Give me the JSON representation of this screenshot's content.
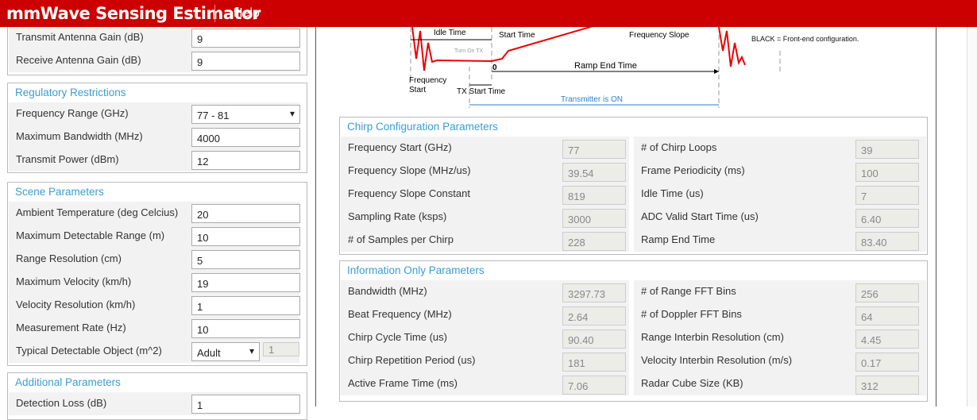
{
  "header": {
    "title": "mmWave Sensing Estimator",
    "help": "Help"
  },
  "antenna": {
    "rows": [
      {
        "label": "Transmit Antenna Gain (dB)",
        "value": "9"
      },
      {
        "label": "Receive Antenna Gain (dB)",
        "value": "9"
      }
    ]
  },
  "regulatory": {
    "title": "Regulatory Restrictions",
    "rows": [
      {
        "label": "Frequency Range (GHz)",
        "value": "77 - 81"
      },
      {
        "label": "Maximum Bandwidth (MHz)",
        "value": "4000"
      },
      {
        "label": "Transmit Power (dBm)",
        "value": "12"
      }
    ]
  },
  "scene": {
    "title": "Scene Parameters",
    "rows": [
      {
        "label": "Ambient Temperature (deg Celcius)",
        "value": "20"
      },
      {
        "label": "Maximum Detectable Range (m)",
        "value": "10"
      },
      {
        "label": "Range Resolution (cm)",
        "value": "5"
      },
      {
        "label": "Maximum Velocity (km/h)",
        "value": "19"
      },
      {
        "label": "Velocity Resolution (km/h)",
        "value": "1"
      },
      {
        "label": "Measurement Rate (Hz)",
        "value": "10"
      }
    ],
    "object_label": "Typical Detectable Object (m^2)",
    "object_value": "Adult",
    "object_rcs": "1"
  },
  "additional": {
    "title": "Additional Parameters",
    "rows": [
      {
        "label": "Detection Loss (dB)",
        "value": "1"
      }
    ]
  },
  "diagram": {
    "idle": "Idle Time",
    "start": "Start Time",
    "slope": "Frequency Slope",
    "legend": "BLACK = Front-end configuration.",
    "turn_on": "Turn On TX",
    "zero": "0",
    "ramp_end": "Ramp End Time",
    "freq_start": "Frequency",
    "freq_start2": "Start",
    "tx_start": "TX Start Time",
    "tx_on": "Transmitter is ON"
  },
  "chirp": {
    "title": "Chirp Configuration Parameters",
    "left": [
      {
        "label": "Frequency Start (GHz)",
        "value": "77"
      },
      {
        "label": "Frequency Slope (MHz/us)",
        "value": "39.54"
      },
      {
        "label": "Frequency Slope Constant",
        "value": "819"
      },
      {
        "label": "Sampling Rate (ksps)",
        "value": "3000"
      },
      {
        "label": "# of Samples per Chirp",
        "value": "228"
      }
    ],
    "right": [
      {
        "label": "# of Chirp Loops",
        "value": "39"
      },
      {
        "label": "Frame Periodicity (ms)",
        "value": "100"
      },
      {
        "label": "Idle Time (us)",
        "value": "7"
      },
      {
        "label": "ADC Valid Start Time (us)",
        "value": "6.40"
      },
      {
        "label": "Ramp End Time",
        "value": "83.40"
      }
    ]
  },
  "info": {
    "title": "Information Only Parameters",
    "left": [
      {
        "label": "Bandwidth (MHz)",
        "value": "3297.73"
      },
      {
        "label": "Beat Frequency (MHz)",
        "value": "2.64"
      },
      {
        "label": "Chirp Cycle Time (us)",
        "value": "90.40"
      },
      {
        "label": "Chirp Repetition Period (us)",
        "value": "181"
      },
      {
        "label": "Active Frame Time (ms)",
        "value": "7.06"
      }
    ],
    "right": [
      {
        "label": "# of Range FFT Bins",
        "value": "256"
      },
      {
        "label": "# of Doppler FFT Bins",
        "value": "64"
      },
      {
        "label": "Range Interbin Resolution (cm)",
        "value": "4.45"
      },
      {
        "label": "Velocity Interbin Resolution (m/s)",
        "value": "0.17"
      },
      {
        "label": "Radar Cube Size (KB)",
        "value": "312"
      }
    ]
  }
}
